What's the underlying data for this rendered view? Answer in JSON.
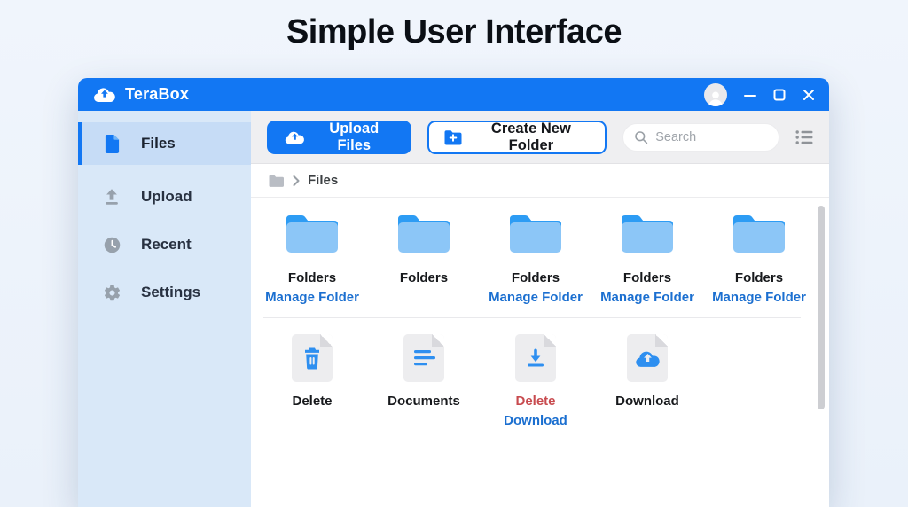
{
  "page": {
    "title": "Simple User Interface"
  },
  "window": {
    "app_name": "TeraBox",
    "titlebar_color": "#1277f3",
    "controls": {
      "minimize": "minimize",
      "maximize": "maximize",
      "close": "close"
    }
  },
  "sidebar": {
    "items": [
      {
        "label": "Files",
        "icon": "file-icon",
        "active": true
      },
      {
        "label": "Upload",
        "icon": "upload-icon",
        "active": false
      },
      {
        "label": "Recent",
        "icon": "clock-icon",
        "active": false
      },
      {
        "label": "Settings",
        "icon": "gear-icon",
        "active": false
      }
    ]
  },
  "toolbar": {
    "upload_button": "Upload Files",
    "create_folder_button": "Create New Folder",
    "search_placeholder": "Search",
    "view_icon": "list-view-icon"
  },
  "breadcrumb": {
    "root_icon": "folder-icon",
    "current": "Files"
  },
  "content": {
    "folders": [
      {
        "name": "Folders",
        "action": "Manage Folder"
      },
      {
        "name": "Folders",
        "action": ""
      },
      {
        "name": "Folders",
        "action": "Manage Folder"
      },
      {
        "name": "Folders",
        "action": "Manage Folder"
      },
      {
        "name": "Folders",
        "action": "Manage Folder"
      }
    ],
    "files": [
      {
        "icon": "trash-icon",
        "label": "Delete",
        "action": ""
      },
      {
        "icon": "document-lines-icon",
        "label": "Documents",
        "action": ""
      },
      {
        "icon": "download-icon",
        "label": "Delete",
        "action": "Download"
      },
      {
        "icon": "cloud-upload-icon",
        "label": "Download",
        "action": ""
      }
    ]
  },
  "colors": {
    "accent_blue": "#1277f3",
    "link_blue": "#1b6fd0",
    "danger_red": "#c84b4f",
    "sidebar_bg": "#d9e8f8",
    "folder_tab": "#2d9cf4",
    "folder_body": "#8cc6f7"
  }
}
